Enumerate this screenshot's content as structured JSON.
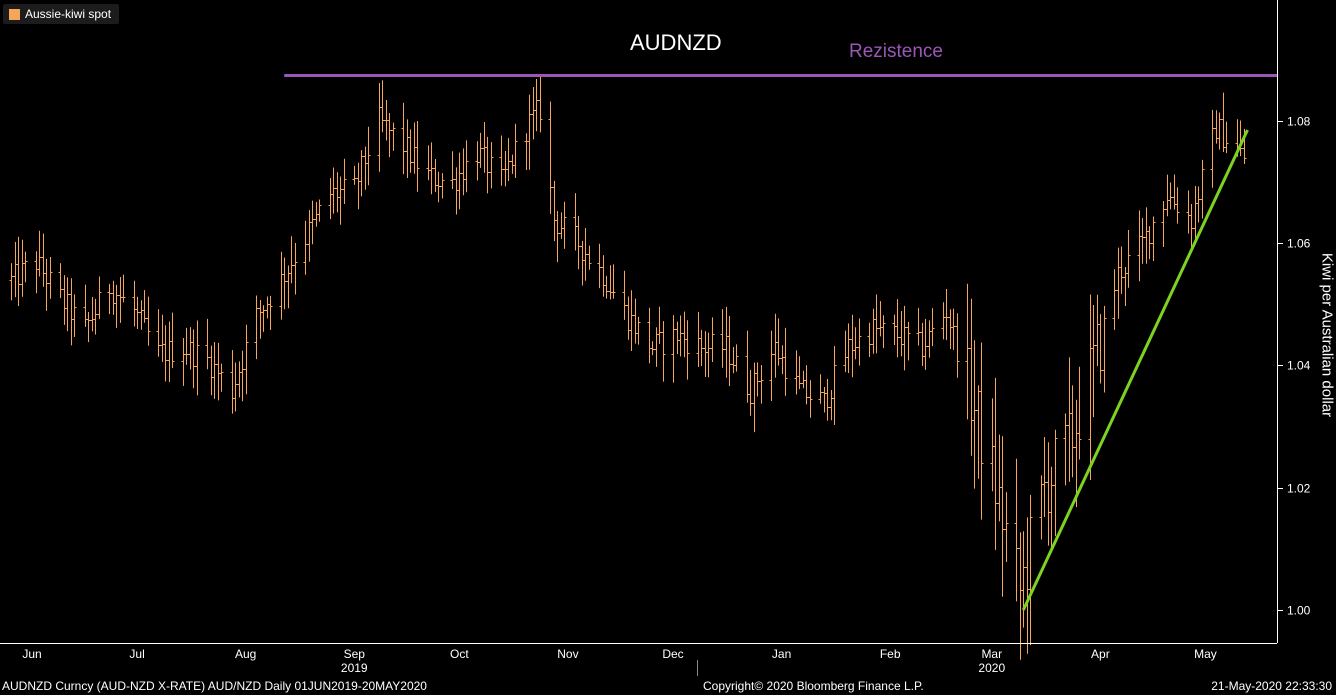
{
  "legend": {
    "label": "Aussie-kiwi spot",
    "color": "#f5a65b"
  },
  "annotations": {
    "title": "AUDNZD",
    "resistance_label": "Rezistence",
    "resistance_color": "#9a57b8",
    "trendline_color": "#7ed321"
  },
  "footer": {
    "left": "AUDNZD Curncy (AUD-NZD X-RATE) AUD/NZD  Daily 01JUN2019-20MAY2020",
    "center": "Copyright© 2020 Bloomberg Finance L.P.",
    "right": "21-May-2020 22:33:30"
  },
  "chart_data": {
    "type": "ohlc",
    "title": "AUDNZD",
    "ylabel": "Kiwi per Australian dollar",
    "ylim": [
      0.9975,
      1.0995
    ],
    "yticks": [
      1.0,
      1.02,
      1.04,
      1.06,
      1.08
    ],
    "ytick_labels": [
      "1.00",
      "1.02",
      "1.04",
      "1.06",
      "1.08"
    ],
    "month_labels": [
      "Jun",
      "Jul",
      "Aug",
      "Sep",
      "Oct",
      "Nov",
      "Dec",
      "Jan",
      "Feb",
      "Mar",
      "Apr",
      "May"
    ],
    "year_labels": [
      {
        "label": "2019",
        "month": "Sep"
      },
      {
        "label": "2020",
        "month": "Mar"
      }
    ],
    "series_color": "#f5a65b",
    "anchors": [
      [
        "2019-06-03",
        1.054
      ],
      [
        "2019-06-10",
        1.057
      ],
      [
        "2019-06-17",
        1.051
      ],
      [
        "2019-06-24",
        1.046
      ],
      [
        "2019-07-01",
        1.053
      ],
      [
        "2019-07-08",
        1.049
      ],
      [
        "2019-07-15",
        1.042
      ],
      [
        "2019-07-22",
        1.043
      ],
      [
        "2019-07-29",
        1.041
      ],
      [
        "2019-08-05",
        1.036
      ],
      [
        "2019-08-12",
        1.048
      ],
      [
        "2019-08-19",
        1.054
      ],
      [
        "2019-08-26",
        1.061
      ],
      [
        "2019-09-02",
        1.068
      ],
      [
        "2019-09-09",
        1.069
      ],
      [
        "2019-09-16",
        1.08
      ],
      [
        "2019-09-23",
        1.076
      ],
      [
        "2019-09-30",
        1.071
      ],
      [
        "2019-10-07",
        1.07
      ],
      [
        "2019-10-14",
        1.075
      ],
      [
        "2019-10-21",
        1.07
      ],
      [
        "2019-10-28",
        1.079
      ],
      [
        "2019-11-01",
        1.082
      ],
      [
        "2019-11-05",
        1.064
      ],
      [
        "2019-11-12",
        1.06
      ],
      [
        "2019-11-19",
        1.055
      ],
      [
        "2019-11-26",
        1.048
      ],
      [
        "2019-12-03",
        1.043
      ],
      [
        "2019-12-10",
        1.045
      ],
      [
        "2019-12-17",
        1.043
      ],
      [
        "2019-12-24",
        1.043
      ],
      [
        "2019-12-31",
        1.036
      ],
      [
        "2020-01-07",
        1.043
      ],
      [
        "2020-01-14",
        1.036
      ],
      [
        "2020-01-21",
        1.034
      ],
      [
        "2020-01-28",
        1.043
      ],
      [
        "2020-02-04",
        1.046
      ],
      [
        "2020-02-11",
        1.045
      ],
      [
        "2020-02-18",
        1.043
      ],
      [
        "2020-02-25",
        1.049
      ],
      [
        "2020-03-03",
        1.035
      ],
      [
        "2020-03-10",
        1.02
      ],
      [
        "2020-03-17",
        1.003
      ],
      [
        "2020-03-24",
        1.02
      ],
      [
        "2020-03-31",
        1.027
      ],
      [
        "2020-04-07",
        1.04
      ],
      [
        "2020-04-14",
        1.055
      ],
      [
        "2020-04-21",
        1.06
      ],
      [
        "2020-04-28",
        1.068
      ],
      [
        "2020-05-05",
        1.064
      ],
      [
        "2020-05-12",
        1.079
      ],
      [
        "2020-05-20",
        1.074
      ]
    ],
    "resistance": {
      "level": 1.0875,
      "from": "2019-08-20",
      "to": "2020-05-20"
    },
    "trendline": {
      "from": [
        "2020-03-18",
        1.0
      ],
      "to": [
        "2020-05-21",
        1.0785
      ]
    }
  }
}
